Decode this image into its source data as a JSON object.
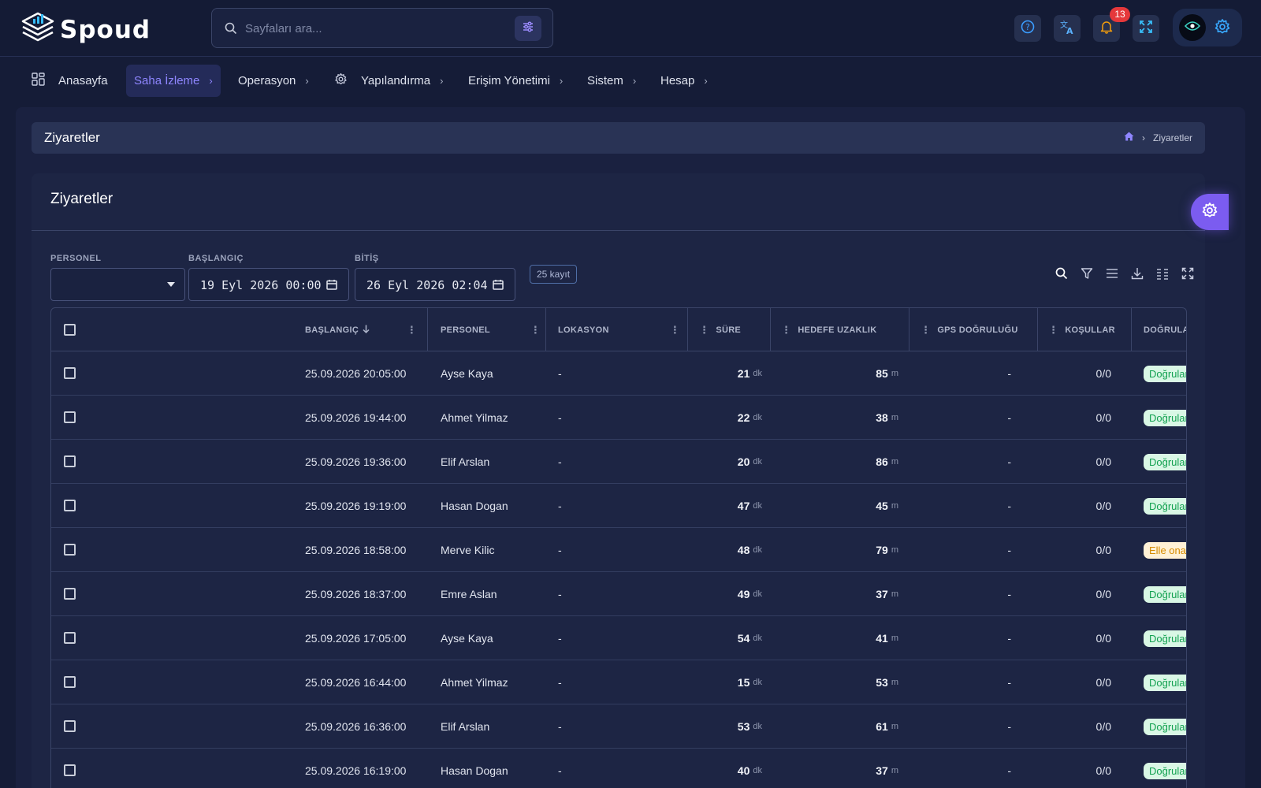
{
  "app": {
    "name": "Spoud"
  },
  "search": {
    "placeholder": "Sayfaları ara..."
  },
  "header_icons": {
    "notifications_count": "13"
  },
  "nav": {
    "items": [
      {
        "label": "Anasayfa"
      },
      {
        "label": "Saha İzleme"
      },
      {
        "label": "Operasyon"
      },
      {
        "label": "Yapılandırma"
      },
      {
        "label": "Erişim Yönetimi"
      },
      {
        "label": "Sistem"
      },
      {
        "label": "Hesap"
      }
    ]
  },
  "page": {
    "title": "Ziyaretler",
    "breadcrumb_current": "Ziyaretler",
    "card_title": "Ziyaretler"
  },
  "filters": {
    "personel_label": "PERSONEL",
    "personel_value": "",
    "start_label": "BAŞLANGIÇ",
    "start_value": "19 Eyl 2026 00:00",
    "end_label": "BİTİŞ",
    "end_value": "26 Eyl 2026 02:04",
    "count_chip": "25 kayıt"
  },
  "table": {
    "columns": {
      "start": "BAŞLANGIÇ",
      "personel": "PERSONEL",
      "lokasyon": "LOKASYON",
      "sure": "SÜRE",
      "hedef": "HEDEFE UZAKLIK",
      "gps": "GPS DOĞRULUĞU",
      "kosul": "KOŞULLAR",
      "dogrulama": "DOĞRULAMA"
    },
    "units": {
      "duration": "dk",
      "distance": "m"
    },
    "rows": [
      {
        "start": "25.09.2026 20:05:00",
        "personel": "Ayse Kaya",
        "lokasyon": "-",
        "sure": "21",
        "hedef": "85",
        "gps": "-",
        "kosul": "0/0",
        "status": "Doğrulandı",
        "status_type": "ok"
      },
      {
        "start": "25.09.2026 19:44:00",
        "personel": "Ahmet Yilmaz",
        "lokasyon": "-",
        "sure": "22",
        "hedef": "38",
        "gps": "-",
        "kosul": "0/0",
        "status": "Doğrulandı",
        "status_type": "ok"
      },
      {
        "start": "25.09.2026 19:36:00",
        "personel": "Elif Arslan",
        "lokasyon": "-",
        "sure": "20",
        "hedef": "86",
        "gps": "-",
        "kosul": "0/0",
        "status": "Doğrulandı",
        "status_type": "ok"
      },
      {
        "start": "25.09.2026 19:19:00",
        "personel": "Hasan Dogan",
        "lokasyon": "-",
        "sure": "47",
        "hedef": "45",
        "gps": "-",
        "kosul": "0/0",
        "status": "Doğrulandı",
        "status_type": "ok"
      },
      {
        "start": "25.09.2026 18:58:00",
        "personel": "Merve Kilic",
        "lokasyon": "-",
        "sure": "48",
        "hedef": "79",
        "gps": "-",
        "kosul": "0/0",
        "status": "Elle onaylandı",
        "status_type": "warn"
      },
      {
        "start": "25.09.2026 18:37:00",
        "personel": "Emre Aslan",
        "lokasyon": "-",
        "sure": "49",
        "hedef": "37",
        "gps": "-",
        "kosul": "0/0",
        "status": "Doğrulandı",
        "status_type": "ok"
      },
      {
        "start": "25.09.2026 17:05:00",
        "personel": "Ayse Kaya",
        "lokasyon": "-",
        "sure": "54",
        "hedef": "41",
        "gps": "-",
        "kosul": "0/0",
        "status": "Doğrulandı",
        "status_type": "ok"
      },
      {
        "start": "25.09.2026 16:44:00",
        "personel": "Ahmet Yilmaz",
        "lokasyon": "-",
        "sure": "15",
        "hedef": "53",
        "gps": "-",
        "kosul": "0/0",
        "status": "Doğrulandı",
        "status_type": "ok"
      },
      {
        "start": "25.09.2026 16:36:00",
        "personel": "Elif Arslan",
        "lokasyon": "-",
        "sure": "53",
        "hedef": "61",
        "gps": "-",
        "kosul": "0/0",
        "status": "Doğrulandı",
        "status_type": "ok"
      },
      {
        "start": "25.09.2026 16:19:00",
        "personel": "Hasan Dogan",
        "lokasyon": "-",
        "sure": "40",
        "hedef": "37",
        "gps": "-",
        "kosul": "0/0",
        "status": "Doğrulandı",
        "status_type": "ok"
      }
    ]
  }
}
